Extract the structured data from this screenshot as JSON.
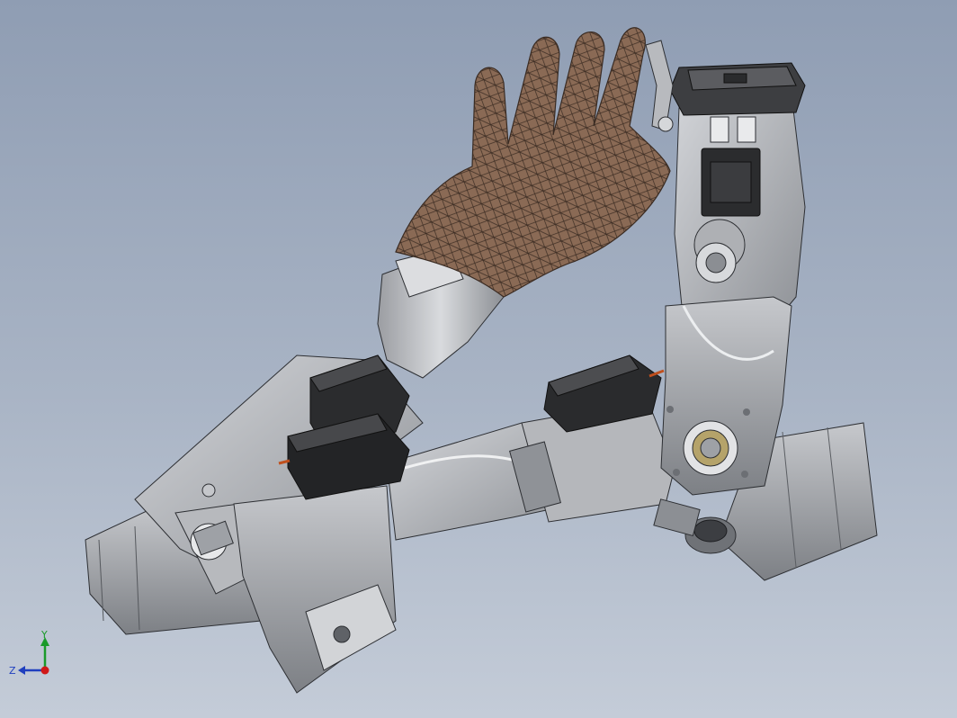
{
  "viewport": {
    "background_top": "#8f9db3",
    "background_bottom": "#c4ccd8"
  },
  "model": {
    "components": [
      "mesh-hand",
      "forearm-sleeve",
      "servo-motor",
      "robotic-arm-link",
      "wrist-bracket",
      "shoulder-cylinder",
      "pulley-gear"
    ],
    "colors": {
      "metal_light": "#c9cbcf",
      "metal_mid": "#a9abb0",
      "metal_dark": "#7e8186",
      "servo": "#2b2c2e",
      "hand_mesh": "#8a6a55",
      "accent_wire": "#c0501e"
    }
  },
  "triad": {
    "y_label": "Y",
    "z_label": "Z",
    "y_color": "#1a9a2a",
    "z_color": "#1f3fbf",
    "x_color": "#d01818"
  }
}
